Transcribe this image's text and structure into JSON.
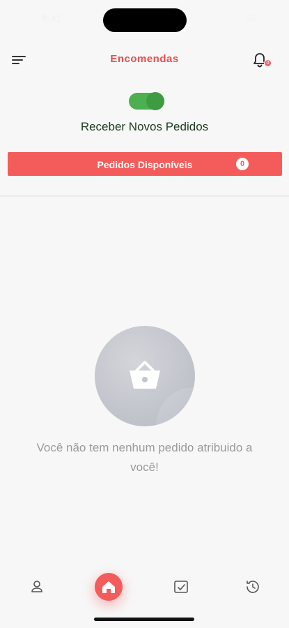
{
  "status_bar": {
    "time": "9:41",
    "right": "5G"
  },
  "header": {
    "title": "Encomendas",
    "notification_count": "0",
    "menu_icon": "sort-lines-icon",
    "bell_icon": "bell-icon"
  },
  "toggle": {
    "label": "Receber Novos Pedidos",
    "on": true,
    "color": "#4caf50"
  },
  "available_orders": {
    "label": "Pedidos Disponíveis",
    "count": "0",
    "color": "#f45b5b"
  },
  "empty_state": {
    "icon": "basket-icon",
    "message": "Você não tem nenhum pedido atribuido a você!"
  },
  "bottom_nav": {
    "items": [
      {
        "icon": "user-icon"
      },
      {
        "icon": "home-icon",
        "active": true
      },
      {
        "icon": "wallet-icon"
      },
      {
        "icon": "history-icon"
      }
    ]
  },
  "colors": {
    "accent": "#e94e4e",
    "background": "#f7f7f7"
  }
}
